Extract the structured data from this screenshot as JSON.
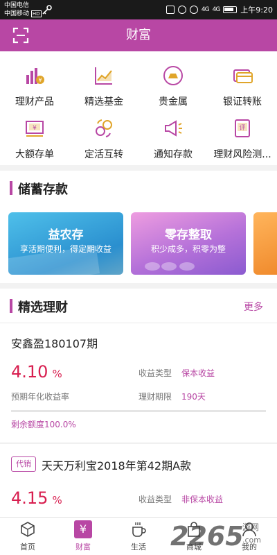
{
  "status_bar": {
    "carrier1": "中国电信",
    "carrier2": "中国移动",
    "hd": "HD",
    "network": "4G",
    "time": "上午9:20"
  },
  "header": {
    "title": "财富",
    "scan_icon": "scan-icon"
  },
  "quick_menu": [
    {
      "label": "理财产品",
      "icon": "bar-chart-coin-icon"
    },
    {
      "label": "精选基金",
      "icon": "line-chart-icon"
    },
    {
      "label": "贵金属",
      "icon": "gold-bar-icon"
    },
    {
      "label": "银证转账",
      "icon": "card-transfer-icon"
    },
    {
      "label": "大额存单",
      "icon": "certificate-icon"
    },
    {
      "label": "定活互转",
      "icon": "exchange-circles-icon"
    },
    {
      "label": "通知存款",
      "icon": "megaphone-icon"
    },
    {
      "label": "理财风险测...",
      "icon": "evaluation-icon"
    }
  ],
  "cert_glyph": "¥",
  "eval_glyph": "评",
  "savings": {
    "title": "储蓄存款",
    "cards": [
      {
        "title": "益农存",
        "subtitle": "享活期便利，得定期收益"
      },
      {
        "title": "零存整取",
        "subtitle": "积少成多，积零为整"
      }
    ]
  },
  "featured": {
    "title": "精选理财",
    "more": "更多",
    "products": [
      {
        "name": "安鑫盈180107期",
        "rate": "4.10",
        "rate_unit": "%",
        "rate_label": "预期年化收益率",
        "type_label": "收益类型",
        "type_value": "保本收益",
        "term_label": "理财期限",
        "term_value": "190天",
        "remaining": "剩余额度100.0%",
        "progress": 1.0
      },
      {
        "tag": "代销",
        "name": "天天万利宝2018年第42期A款",
        "rate": "4.15",
        "rate_unit": "%",
        "type_label": "收益类型",
        "type_value": "非保本收益"
      }
    ]
  },
  "tabbar": [
    {
      "label": "首页",
      "icon": "home-icon"
    },
    {
      "label": "财富",
      "icon": "wealth-icon",
      "glyph": "¥",
      "active": true
    },
    {
      "label": "生活",
      "icon": "coffee-cup-icon"
    },
    {
      "label": "商城",
      "icon": "shopping-bag-icon"
    },
    {
      "label": "我的",
      "icon": "profile-icon"
    }
  ],
  "watermark": {
    "text": "2265",
    "site": "游网",
    "domain": ".com"
  },
  "colors": {
    "primary": "#b847a4",
    "rate": "#d81e4f",
    "icon_gold": "#e0a52a"
  }
}
